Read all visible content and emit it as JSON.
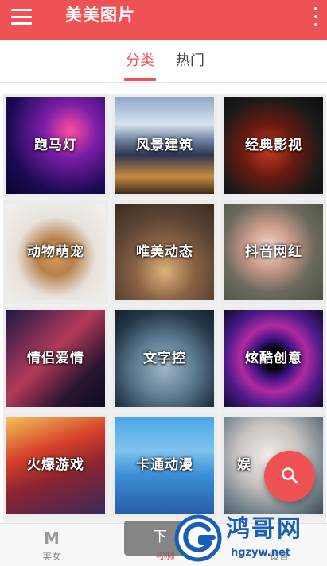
{
  "app": {
    "title": "美美图片"
  },
  "tabs": [
    {
      "label": "分类",
      "active": true
    },
    {
      "label": "热门",
      "active": false
    }
  ],
  "categories": [
    {
      "label": "跑马灯"
    },
    {
      "label": "风景建筑"
    },
    {
      "label": "经典影视"
    },
    {
      "label": "动物萌宠"
    },
    {
      "label": "唯美动态"
    },
    {
      "label": "抖音网红"
    },
    {
      "label": "情侣爱情"
    },
    {
      "label": "文字控"
    },
    {
      "label": "炫酷创意"
    },
    {
      "label": "火爆游戏"
    },
    {
      "label": "卡通动漫"
    },
    {
      "label": "娱"
    }
  ],
  "bottom_nav": [
    {
      "glyph": "M",
      "label": "美女"
    },
    {
      "glyph": "",
      "label": "视频"
    },
    {
      "glyph": "",
      "label": "设置"
    }
  ],
  "toast": {
    "text": "下"
  },
  "watermark": {
    "brand": "鸿哥网",
    "url": "hgzyw.net"
  },
  "colors": {
    "accent": "#ee5254",
    "watermark": "#1b5fb4"
  },
  "icons": {
    "menu": "menu-icon",
    "more": "more-vertical-icon",
    "fab": "search-icon"
  }
}
